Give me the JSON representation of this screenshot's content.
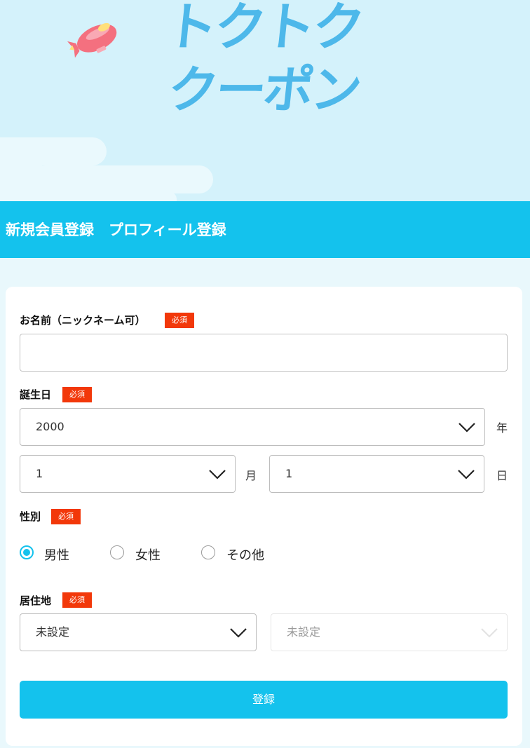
{
  "logo": {
    "line1": "トクトク",
    "line2": "クーポン"
  },
  "page_title": "新規会員登録　プロフィール登録",
  "badge_required": "必須",
  "name_field": {
    "label": "お名前（ニックネーム可）",
    "value": "",
    "placeholder": ""
  },
  "birthday": {
    "label": "誕生日",
    "year_value": "2000",
    "year_unit": "年",
    "month_value": "1",
    "month_unit": "月",
    "day_value": "1",
    "day_unit": "日"
  },
  "gender": {
    "label": "性別",
    "options": [
      "男性",
      "女性",
      "その他"
    ],
    "selected": "男性"
  },
  "residence": {
    "label": "居住地",
    "prefecture_value": "未設定",
    "city_value": "未設定"
  },
  "submit_label": "登録",
  "colors": {
    "accent": "#14c2ed",
    "badge": "#f2380a",
    "logo": "#4db8ea",
    "hero_bg": "#d4f2fb"
  }
}
